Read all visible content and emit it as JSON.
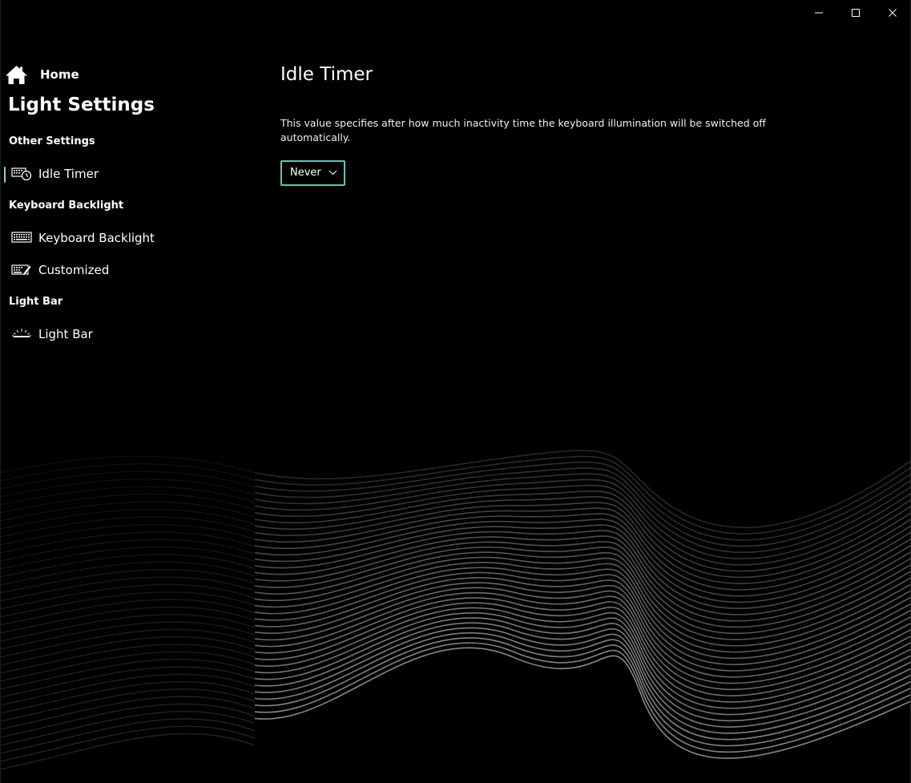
{
  "window": {
    "controls": {
      "minimize_icon": "minimize-icon",
      "maximize_icon": "maximize-icon",
      "close_icon": "close-icon"
    }
  },
  "sidebar": {
    "home_label": "Home",
    "home_icon": "home-icon",
    "app_title": "Light Settings",
    "sections": [
      {
        "header": "Other Settings",
        "items": [
          {
            "label": "Idle Timer",
            "icon": "keyboard-timer-icon",
            "selected": true
          }
        ]
      },
      {
        "header": "Keyboard Backlight",
        "items": [
          {
            "label": "Keyboard Backlight",
            "icon": "keyboard-icon",
            "selected": false
          },
          {
            "label": "Customized",
            "icon": "keyboard-edit-icon",
            "selected": false
          }
        ]
      },
      {
        "header": "Light Bar",
        "items": [
          {
            "label": "Light Bar",
            "icon": "light-bar-icon",
            "selected": false
          }
        ]
      }
    ]
  },
  "main": {
    "title": "Idle Timer",
    "description": "This value specifies after how much inactivity time the keyboard illumination will be switched off automatically.",
    "idle_timer_select": {
      "value": "Never",
      "icon": "chevron-down-icon"
    }
  },
  "colors": {
    "background": "#000000",
    "accent": "#5ec6b6",
    "text": "#ffffff"
  }
}
